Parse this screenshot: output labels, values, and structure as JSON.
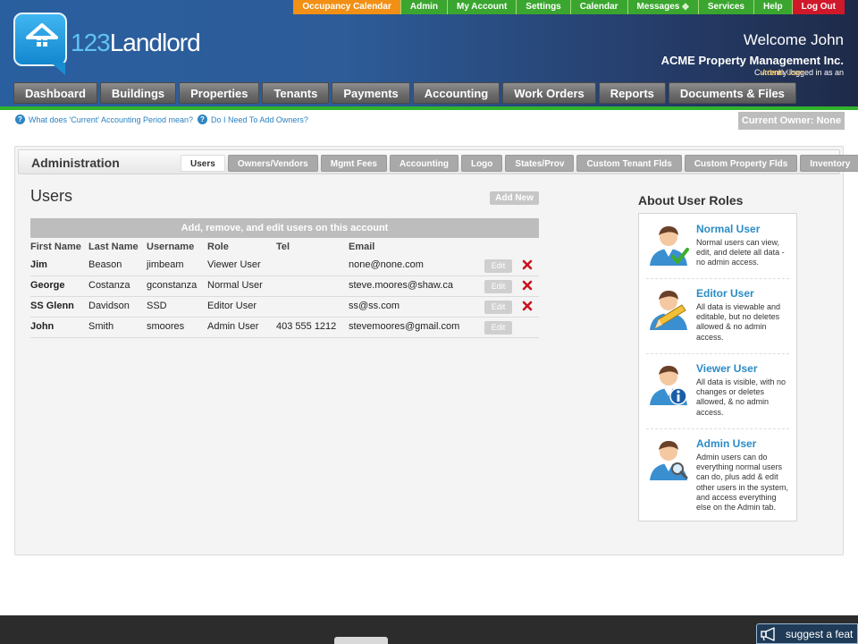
{
  "topnav": {
    "items": [
      "Occupancy Calendar",
      "Admin",
      "My Account",
      "Settings",
      "Calendar",
      "Messages",
      "Services",
      "Help",
      "Log Out"
    ]
  },
  "logo": {
    "number": "123",
    "word": "Landlord"
  },
  "header": {
    "welcome": "Welcome John",
    "company": "ACME Property Management Inc.",
    "logged_in_prefix": "Currently logged in as an ",
    "logged_in_role": "Admin User"
  },
  "mainnav": {
    "items": [
      "Dashboard",
      "Buildings",
      "Properties",
      "Tenants",
      "Payments",
      "Accounting",
      "Work Orders",
      "Reports",
      "Documents & Files"
    ]
  },
  "helpbar": {
    "link1": "What does 'Current' Accounting Period mean?",
    "link2": "Do I Need To Add Owners?",
    "current_owner": "Current Owner: None"
  },
  "admin": {
    "title": "Administration",
    "tabs": [
      "Users",
      "Owners/Vendors",
      "Mgmt Fees",
      "Accounting",
      "Logo",
      "States/Prov",
      "Custom Tenant Flds",
      "Custom Property Flds",
      "Inventory"
    ],
    "active_tab": "Users"
  },
  "users": {
    "title": "Users",
    "add_new": "Add New",
    "caption": "Add, remove, and edit users on this account",
    "columns": [
      "First Name",
      "Last Name",
      "Username",
      "Role",
      "Tel",
      "Email"
    ],
    "edit_label": "Edit",
    "rows": [
      {
        "first": "Jim",
        "last": "Beason",
        "username": "jimbeam",
        "role": "Viewer User",
        "tel": "",
        "email": "none@none.com"
      },
      {
        "first": "George",
        "last": "Costanza",
        "username": "gconstanza",
        "role": "Normal User",
        "tel": "",
        "email": "steve.moores@shaw.ca"
      },
      {
        "first": "SS Glenn",
        "last": "Davidson",
        "username": "SSD",
        "role": "Editor User",
        "tel": "",
        "email": "ss@ss.com"
      },
      {
        "first": "John",
        "last": "Smith",
        "username": "smoores",
        "role": "Admin User",
        "tel": "403 555 1212",
        "email": "stevemoores@gmail.com"
      }
    ]
  },
  "about": {
    "title": "About User Roles",
    "roles": [
      {
        "name": "Normal User",
        "desc": "Normal users can view, edit, and delete all data - no admin access.",
        "badge": "check-icon"
      },
      {
        "name": "Editor User",
        "desc": "All data is viewable and editable, but no deletes allowed & no admin access.",
        "badge": "pencil-icon"
      },
      {
        "name": "Viewer User",
        "desc": "All data is visible, with no changes or deletes allowed, & no admin access.",
        "badge": "info-icon"
      },
      {
        "name": "Admin User",
        "desc": "Admin users can do everything normal users can do, plus add & edit other users in the system, and access everything else on the Admin tab.",
        "badge": "magnifier-icon"
      }
    ]
  },
  "footer": {
    "suggest": "suggest a feat"
  },
  "colors": {
    "header_blue": "#2a5f9f",
    "nav_green": "#3aa62f",
    "nav_orange": "#f29015",
    "logout_red": "#d0182b",
    "link_blue": "#2a82c0"
  }
}
